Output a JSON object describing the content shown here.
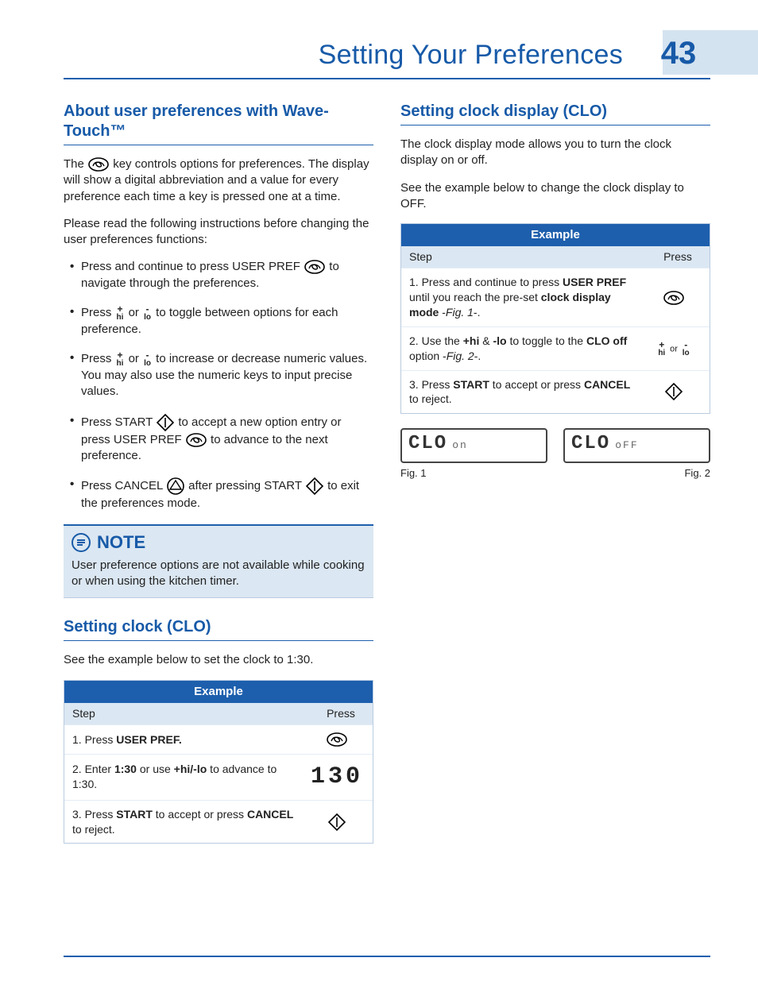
{
  "head": {
    "title": "Setting Your Preferences",
    "number": "43"
  },
  "left": {
    "h_about": "About user preferences with Wave-Touch™",
    "p_intro1a": "The ",
    "p_intro1b": " key controls options for preferences. The display will show a digital abbreviation and a value for every preference each time a key is pressed one at a time.",
    "p_intro2": "Please read the following instructions before changing the user preferences functions:",
    "b1a": "Press and continue to press USER PREF ",
    "b1b": " to navigate through the preferences.",
    "b2a": "Press ",
    "b2b": " or ",
    "b2c": " to toggle between options for each preference.",
    "b3a": "Press ",
    "b3b": " or ",
    "b3c": " to increase or decrease numeric values. You may also use the numeric keys to input precise values.",
    "b4a": "Press START ",
    "b4b": " to accept a new option entry or press USER PREF ",
    "b4c": " to advance to the next preference.",
    "b5a": "Press CANCEL ",
    "b5b": " after pressing START ",
    "b5c": " to exit the preferences mode.",
    "note_head": "NOTE",
    "note_body": "User preference options are not available while cooking or when using the kitchen timer.",
    "h_clo": "Setting clock (CLO)",
    "p_clo": "See the example below to set the clock to 1:30.",
    "tbl": {
      "title": "Example",
      "col_step": "Step",
      "col_press": "Press",
      "r1_pre": "Press ",
      "r1_b": "USER PREF.",
      "r2_pre": "Enter ",
      "r2_b1": "1:30",
      "r2_mid": " or use ",
      "r2_b2": "+hi/-lo",
      "r2_post": " to advance to 1:30.",
      "r2_press": "130",
      "r3_pre": "Press ",
      "r3_b1": "START",
      "r3_mid": " to accept or press ",
      "r3_b2": "CANCEL",
      "r3_post": " to reject."
    }
  },
  "right": {
    "h_disp": "Setting clock display (CLO)",
    "p1": "The clock display mode allows you to turn the clock display on or off.",
    "p2": "See the example below to change the clock display to OFF.",
    "tbl": {
      "title": "Example",
      "col_step": "Step",
      "col_press": "Press",
      "r1_pre": "Press and continue to press ",
      "r1_b1": "USER PREF",
      "r1_mid1": " until you reach the pre-set ",
      "r1_b2": "clock display mode",
      "r1_mid2": " -",
      "r1_i": "Fig. 1",
      "r1_post": "-.",
      "r2_pre": "Use the ",
      "r2_b1": "+hi",
      "r2_amp": " & ",
      "r2_b2": "-lo",
      "r2_mid": " to toggle to the ",
      "r2_b3": "CLO off",
      "r2_mid2": " option  -",
      "r2_i": "Fig. 2",
      "r2_post": "-.",
      "r2_or": "or",
      "r3_pre": "Press ",
      "r3_b1": "START",
      "r3_mid": " to accept or press ",
      "r3_b2": "CANCEL",
      "r3_post": " to reject."
    },
    "lcd1_big": "CLO",
    "lcd1_sm": "on",
    "lcd2_big": "CLO",
    "lcd2_sm": "oFF",
    "fig1": "Fig. 1",
    "fig2": "Fig. 2"
  },
  "glyph": {
    "hi_sign": "+",
    "hi_lbl": "hi",
    "lo_sign": "-",
    "lo_lbl": "lo"
  }
}
